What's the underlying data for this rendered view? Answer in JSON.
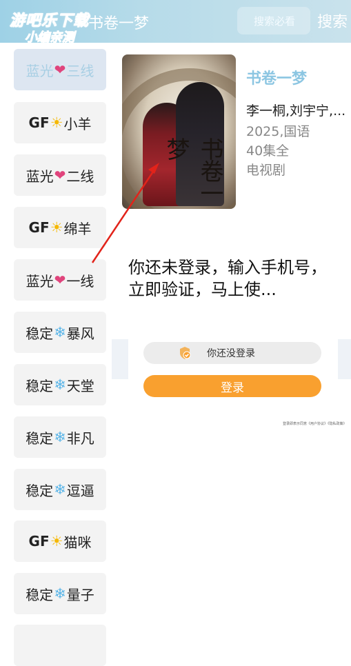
{
  "watermark": {
    "line1": "游吧乐下载",
    "line2": "小编亲测"
  },
  "header": {
    "title": "书卷一梦",
    "search_placeholder": "搜索必看",
    "search_button": "搜索"
  },
  "sidebar": {
    "items": [
      {
        "prefix": "蓝光",
        "icon": "heart-icon",
        "glyph": "❤",
        "suffix": "三线",
        "active": true
      },
      {
        "prefix": "GF",
        "icon": "sun-icon",
        "glyph": "☀",
        "suffix": "小羊"
      },
      {
        "prefix": "蓝光",
        "icon": "heart-icon",
        "glyph": "❤",
        "suffix": "二线"
      },
      {
        "prefix": "GF",
        "icon": "sun-icon",
        "glyph": "☀",
        "suffix": "绵羊"
      },
      {
        "prefix": "蓝光",
        "icon": "heart-icon",
        "glyph": "❤",
        "suffix": "一线"
      },
      {
        "prefix": "稳定",
        "icon": "snowflake-icon",
        "glyph": "❄",
        "suffix": "暴风"
      },
      {
        "prefix": "稳定",
        "icon": "snowflake-icon",
        "glyph": "❄",
        "suffix": "天堂"
      },
      {
        "prefix": "稳定",
        "icon": "snowflake-icon",
        "glyph": "❄",
        "suffix": "非凡"
      },
      {
        "prefix": "稳定",
        "icon": "snowflake-icon",
        "glyph": "❄",
        "suffix": "逗逼"
      },
      {
        "prefix": "GF",
        "icon": "sun-icon",
        "glyph": "☀",
        "suffix": "猫咪"
      },
      {
        "prefix": "稳定",
        "icon": "snowflake-icon",
        "glyph": "❄",
        "suffix": "量子"
      }
    ]
  },
  "poster": {
    "calligraphy": "书卷一梦"
  },
  "info": {
    "title": "书卷一梦",
    "cast": "李一桐,刘宇宁,...",
    "year_region": "2025,国语",
    "episodes": "40集全",
    "category": "电视剧"
  },
  "login": {
    "message": "你还未登录，输入手机号，立即验证，马上使...",
    "status_text": "你还没登录",
    "button": "登录",
    "agreement": "登录即表示同意《用户协议》《隐私政策》"
  },
  "colors": {
    "accent": "#8cc6e2",
    "login_button": "#f9a02f",
    "arrow": "#e2231a"
  }
}
